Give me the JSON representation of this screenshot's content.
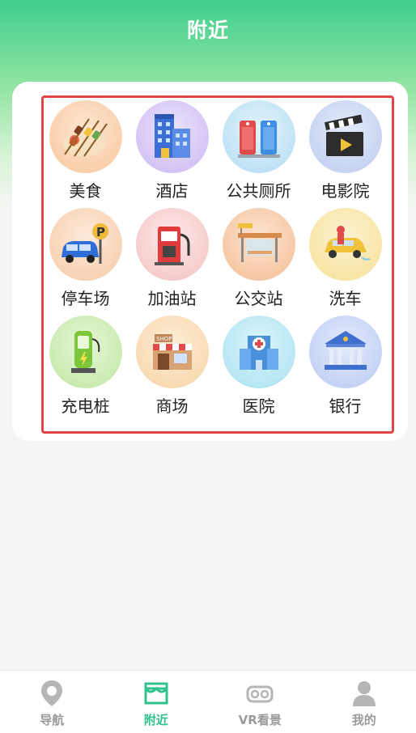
{
  "header": {
    "title": "附近"
  },
  "grid": {
    "items": [
      {
        "label": "美食",
        "icon": "food-icon",
        "bg": "#fbd6b9"
      },
      {
        "label": "酒店",
        "icon": "hotel-icon",
        "bg": "#d9cbf7"
      },
      {
        "label": "公共厕所",
        "icon": "toilet-icon",
        "bg": "#c6e6f7"
      },
      {
        "label": "电影院",
        "icon": "cinema-icon",
        "bg": "#cfd9f3"
      },
      {
        "label": "停车场",
        "icon": "parking-icon",
        "bg": "#fbdcc4"
      },
      {
        "label": "加油站",
        "icon": "gas-station-icon",
        "bg": "#fbd6d6"
      },
      {
        "label": "公交站",
        "icon": "bus-stop-icon",
        "bg": "#fbd2b7"
      },
      {
        "label": "洗车",
        "icon": "car-wash-icon",
        "bg": "#fbeab6"
      },
      {
        "label": "充电桩",
        "icon": "charging-pile-icon",
        "bg": "#d6f0c2"
      },
      {
        "label": "商场",
        "icon": "mall-icon",
        "bg": "#fbe3c6"
      },
      {
        "label": "医院",
        "icon": "hospital-icon",
        "bg": "#c2ecf7"
      },
      {
        "label": "银行",
        "icon": "bank-icon",
        "bg": "#cfd9f7"
      }
    ]
  },
  "tabbar": {
    "tabs": [
      {
        "label": "导航",
        "icon": "map-pin-icon",
        "active": false
      },
      {
        "label": "附近",
        "icon": "store-icon",
        "active": true
      },
      {
        "label": "VR看景",
        "icon": "vr-goggles-icon",
        "active": false
      },
      {
        "label": "我的",
        "icon": "user-icon",
        "active": false
      }
    ],
    "active_color": "#2fc28a",
    "inactive_color": "#9a9a9a"
  }
}
